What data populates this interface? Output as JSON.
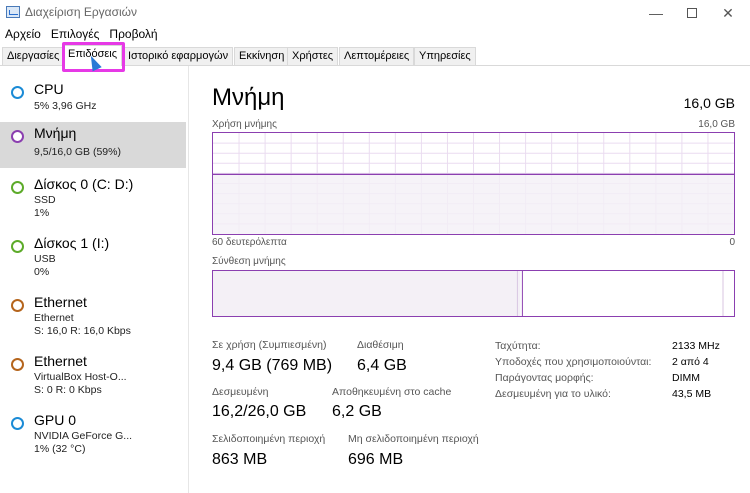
{
  "window": {
    "title": "Διαχείριση Εργασιών"
  },
  "menu": [
    "Αρχείο",
    "Επιλογές",
    "Προβολή"
  ],
  "tabs": [
    {
      "label": "Διεργασίες"
    },
    {
      "label": "Επιδόσεις"
    },
    {
      "label": "Ιστορικό εφαρμογών"
    },
    {
      "label": "Εκκίνηση"
    },
    {
      "label": "Χρήστες"
    },
    {
      "label": "Λεπτομέρειες"
    },
    {
      "label": "Υπηρεσίες"
    }
  ],
  "sidebar": [
    {
      "name": "CPU",
      "sub1": "5% 3,96 GHz",
      "sub2": "",
      "color": "#1b8bd6"
    },
    {
      "name": "Μνήμη",
      "sub1": "9,5/16,0 GB (59%)",
      "sub2": "",
      "color": "#8b3fb0"
    },
    {
      "name": "Δίσκος 0 (C: D:)",
      "sub1": "SSD",
      "sub2": "1%",
      "color": "#5dab2a"
    },
    {
      "name": "Δίσκος 1 (I:)",
      "sub1": "USB",
      "sub2": "0%",
      "color": "#5dab2a"
    },
    {
      "name": "Ethernet",
      "sub1": "Ethernet",
      "sub2": "S: 16,0 R: 16,0 Kbps",
      "color": "#b5651d"
    },
    {
      "name": "Ethernet",
      "sub1": "VirtualBox Host-O...",
      "sub2": "S: 0 R: 0 Kbps",
      "color": "#b5651d"
    },
    {
      "name": "GPU 0",
      "sub1": "NVIDIA GeForce G...",
      "sub2": "1% (32 °C)",
      "color": "#1b8bd6"
    }
  ],
  "main": {
    "title": "Μνήμη",
    "total": "16,0 GB",
    "usage_label": "Χρήση μνήμης",
    "usage_max": "16,0 GB",
    "time_label": "60 δευτερόλεπτα",
    "time_end": "0",
    "composition_label": "Σύνθεση μνήμης",
    "accent": "#8b3fb0",
    "usage_fraction": 0.59,
    "composition_in_use_fraction": 0.59
  },
  "stats": {
    "in_use_label": "Σε χρήση (Συμπιεσμένη)",
    "in_use_value": "9,4 GB (769 MB)",
    "available_label": "Διαθέσιμη",
    "available_value": "6,4 GB",
    "committed_label": "Δεσμευμένη",
    "committed_value": "16,2/26,0 GB",
    "cached_label": "Αποθηκευμένη στο cache",
    "cached_value": "6,2 GB",
    "paged_label": "Σελιδοποιημένη περιοχή",
    "paged_value": "863 MB",
    "nonpaged_label": "Μη σελιδοποιημένη περιοχή",
    "nonpaged_value": "696 MB"
  },
  "properties": [
    {
      "label": "Ταχύτητα:",
      "value": "2133 MHz"
    },
    {
      "label": "Υποδοχές που χρησιμοποιούνται:",
      "value": "2 από 4"
    },
    {
      "label": "Παράγοντας μορφής:",
      "value": "DIMM"
    },
    {
      "label": "Δεσμευμένη για το υλικό:",
      "value": "43,5 MB"
    }
  ]
}
